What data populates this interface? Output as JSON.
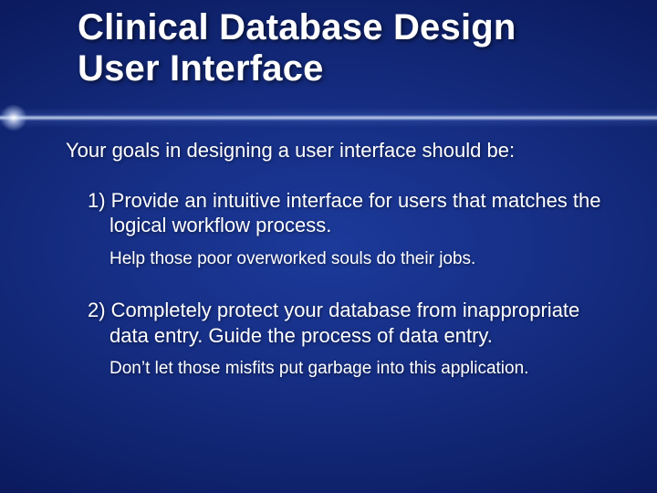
{
  "title_line1": "Clinical Database Design",
  "title_line2": "User Interface",
  "intro": "Your goals in designing a user interface should be:",
  "points": [
    {
      "text": "1) Provide an intuitive interface for users that matches the logical workflow process.",
      "aside": "Help those poor overworked souls do their jobs."
    },
    {
      "text": "2) Completely protect your database from inappropriate data entry.  Guide the process of data entry.",
      "aside": "Don’t let those misfits put garbage into this application."
    }
  ]
}
